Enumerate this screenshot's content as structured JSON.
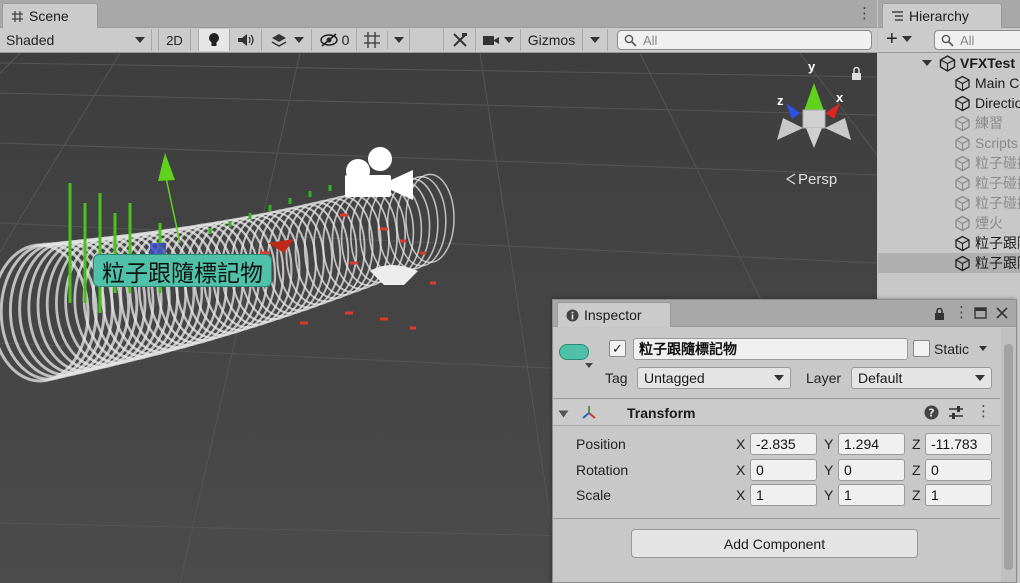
{
  "scene": {
    "tab_label": "Scene",
    "toolbar": {
      "shading_mode": "Shaded",
      "mode_2d": "2D",
      "hidden_count": "0",
      "gizmos_label": "Gizmos",
      "search_placeholder": "All"
    },
    "gizmo": {
      "y": "y",
      "x": "x",
      "z": "z",
      "projection": "Persp"
    },
    "object_label": "粒子跟隨標記物"
  },
  "hierarchy": {
    "tab_label": "Hierarchy",
    "search_placeholder": "All",
    "scene_name": "VFXTest",
    "items": [
      {
        "label": "Main Camera",
        "active": true
      },
      {
        "label": "Directional Light",
        "active": true
      },
      {
        "label": "練習",
        "active": false
      },
      {
        "label": "Scripts",
        "active": false
      },
      {
        "label": "粒子碰撞",
        "active": false
      },
      {
        "label": "粒子碰撞",
        "active": false
      },
      {
        "label": "粒子碰撞",
        "active": false
      },
      {
        "label": "煙火",
        "active": false
      },
      {
        "label": "粒子跟隨",
        "active": true
      },
      {
        "label": "粒子跟隨標記物",
        "active": true,
        "selected": true
      }
    ]
  },
  "inspector": {
    "tab_label": "Inspector",
    "object_name": "粒子跟隨標記物",
    "active_checked": true,
    "static_label": "Static",
    "static_checked": false,
    "tag_label": "Tag",
    "tag_value": "Untagged",
    "layer_label": "Layer",
    "layer_value": "Default",
    "transform": {
      "title": "Transform",
      "position_label": "Position",
      "rotation_label": "Rotation",
      "scale_label": "Scale",
      "axis_x": "X",
      "axis_y": "Y",
      "axis_z": "Z",
      "position": {
        "x": "-2.835",
        "y": "1.294",
        "z": "-11.783"
      },
      "rotation": {
        "x": "0",
        "y": "0",
        "z": "0"
      },
      "scale": {
        "x": "1",
        "y": "1",
        "z": "1"
      }
    },
    "add_component_label": "Add Component"
  },
  "colors": {
    "label_teal": "#4fc1a8",
    "gizmo_x": "#e3241c",
    "gizmo_y": "#5fd21c",
    "gizmo_z": "#2a52e8"
  }
}
